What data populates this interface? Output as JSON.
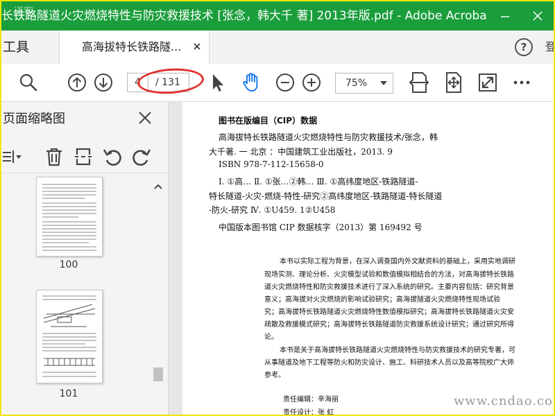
{
  "window": {
    "title": "长铁路隧道火灾燃烧特性与防灾救援技术 [张念，韩大千 著] 2013年版.pdf - Adobe Acrobat Pro...",
    "watermark": "道客"
  },
  "tabs": {
    "tools_label": "工具",
    "doc_tab_label": "高海拔特长铁路隧...",
    "help_icon": "?",
    "right_fragment": "登"
  },
  "toolbar": {
    "current_page": "4",
    "total_pages": "/ 131",
    "zoom": "75%"
  },
  "thumbnails": {
    "title": "页面缩略图",
    "pages": [
      "100",
      "101"
    ]
  },
  "document": {
    "cip_title": "图书在版编目（CIP）数据",
    "cip_lines": [
      "高海拔特长铁路隧道火灾燃烧特性与防灾救援技术/张念，韩",
      "大千著. 一 北京 ：中国建筑工业出版社，2013. 9",
      "ISBN 978-7-112-15658-0",
      "Ⅰ. ①高…  Ⅱ. ①张…②韩…  Ⅲ. ①高纬度地区-铁路隧道-",
      "特长隧道-火灾-燃烧-特性-研究②高纬度地区-铁路隧道-特长隧道",
      "-防火-研究  Ⅳ. ①U459. 1②U458",
      "中国版本图书馆 CIP 数据核字（2013）第 169492 号"
    ],
    "abstract_lines": [
      "本书以实际工程为背景，在深入调查国内外文献资料的基础上，采用实地调研",
      "现场实测、理论分析、火灾模型试验和数值模拟相结合的方法，对高海拔特长铁路",
      "道火灾燃烧特性和防灾救援技术进行了深入系统的研究。主要内容包括：研究背景",
      "意义；高海拔对火灾燃烧的影响试验研究；高海拔隧道火灾燃烧特性现场试验",
      "究；高海拔特长铁路隧道火灾燃烧特性数值模拟研究；高海拔特长铁路隧道火灾安",
      "疏散及救援模式研究；高海拔特长铁路隧道防灾救援系统设计研究；通过研究所得",
      "论。",
      "本书是关于高海拔特长铁路隧道火灾燃烧特性与防灾救援技术的研究专著，可",
      "从事隧道及地下工程等防火和防灾设计、施工、科研技术人员以及高等院校广大师",
      "参考。"
    ],
    "credits": [
      "责任编辑：辛海丽",
      "责任设计：张    虹"
    ]
  },
  "site_watermark": "www.cndao.com",
  "colors": {
    "titlebar": "#1a9e3c",
    "hand_tool_active": "#1473e6",
    "annotation": "#e0322e",
    "frame_border": "#f3e600"
  }
}
